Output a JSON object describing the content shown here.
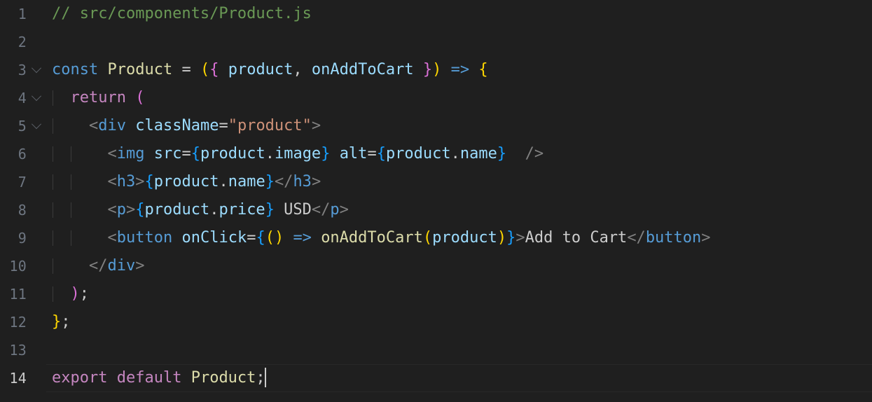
{
  "editor": {
    "file_name": "Product.js",
    "language": "javascript-react",
    "theme": "Dark Modern",
    "font_size_px": 22,
    "line_height_px": 40,
    "total_lines": 14,
    "active_line": 14,
    "cursor": {
      "line": 14,
      "column": 24
    },
    "colors": {
      "background": "#1f1f1f",
      "foreground": "#cccccc",
      "line_number": "#6e7681",
      "line_number_active": "#cccccc",
      "comment": "#6a9955",
      "keyword": "#569cd6",
      "control_keyword": "#c586c0",
      "identifier_type": "#dcdcaa",
      "variable": "#9cdcfe",
      "function": "#dcdcaa",
      "string": "#ce9178",
      "punctuation": "#808080",
      "bracket_level_1": "#ffd700",
      "bracket_level_2": "#da70d6",
      "bracket_level_3": "#179fff",
      "indent_guide": "#3b3b3b",
      "active_line_border": "#282828"
    }
  },
  "lines": [
    {
      "number": "1",
      "foldable": false,
      "indent_guides": 0,
      "plain_text": "// src/components/Product.js",
      "tokens": [
        {
          "text": "// src/components/Product.js",
          "cls": "t-comment"
        }
      ]
    },
    {
      "number": "2",
      "foldable": false,
      "indent_guides": 0,
      "plain_text": "",
      "tokens": []
    },
    {
      "number": "3",
      "foldable": true,
      "indent_guides": 0,
      "plain_text": "const Product = ({ product, onAddToCart }) => {",
      "tokens": [
        {
          "text": "const",
          "cls": "t-keyword"
        },
        {
          "text": " ",
          "cls": "t-plain"
        },
        {
          "text": "Product",
          "cls": "t-type"
        },
        {
          "text": " ",
          "cls": "t-plain"
        },
        {
          "text": "=",
          "cls": "t-plain"
        },
        {
          "text": " ",
          "cls": "t-plain"
        },
        {
          "text": "(",
          "cls": "b1"
        },
        {
          "text": "{",
          "cls": "b2"
        },
        {
          "text": " ",
          "cls": "t-plain"
        },
        {
          "text": "product",
          "cls": "t-var"
        },
        {
          "text": ",",
          "cls": "t-plain"
        },
        {
          "text": " ",
          "cls": "t-plain"
        },
        {
          "text": "onAddToCart",
          "cls": "t-var"
        },
        {
          "text": " ",
          "cls": "t-plain"
        },
        {
          "text": "}",
          "cls": "b2"
        },
        {
          "text": ")",
          "cls": "b1"
        },
        {
          "text": " ",
          "cls": "t-plain"
        },
        {
          "text": "=>",
          "cls": "t-arrow"
        },
        {
          "text": " ",
          "cls": "t-plain"
        },
        {
          "text": "{",
          "cls": "b1"
        }
      ]
    },
    {
      "number": "4",
      "foldable": true,
      "indent_guides": 1,
      "plain_text": "  return (",
      "tokens": [
        {
          "text": "  ",
          "cls": "t-plain"
        },
        {
          "text": "return",
          "cls": "t-control"
        },
        {
          "text": " ",
          "cls": "t-plain"
        },
        {
          "text": "(",
          "cls": "b2"
        }
      ]
    },
    {
      "number": "5",
      "foldable": true,
      "indent_guides": 1,
      "plain_text": "    <div className=\"product\">",
      "tokens": [
        {
          "text": "    ",
          "cls": "t-plain"
        },
        {
          "text": "<",
          "cls": "t-bracket-punct"
        },
        {
          "text": "div",
          "cls": "t-tag"
        },
        {
          "text": " ",
          "cls": "t-plain"
        },
        {
          "text": "className",
          "cls": "t-var"
        },
        {
          "text": "=",
          "cls": "t-plain"
        },
        {
          "text": "\"product\"",
          "cls": "t-string"
        },
        {
          "text": ">",
          "cls": "t-bracket-punct"
        }
      ]
    },
    {
      "number": "6",
      "foldable": false,
      "indent_guides": 2,
      "plain_text": "      <img src={product.image} alt={product.name}  />",
      "tokens": [
        {
          "text": "      ",
          "cls": "t-plain"
        },
        {
          "text": "<",
          "cls": "t-bracket-punct"
        },
        {
          "text": "img",
          "cls": "t-tag"
        },
        {
          "text": " ",
          "cls": "t-plain"
        },
        {
          "text": "src",
          "cls": "t-var"
        },
        {
          "text": "=",
          "cls": "t-plain"
        },
        {
          "text": "{",
          "cls": "b3"
        },
        {
          "text": "product",
          "cls": "t-var"
        },
        {
          "text": ".",
          "cls": "t-plain"
        },
        {
          "text": "image",
          "cls": "t-var"
        },
        {
          "text": "}",
          "cls": "b3"
        },
        {
          "text": " ",
          "cls": "t-plain"
        },
        {
          "text": "alt",
          "cls": "t-var"
        },
        {
          "text": "=",
          "cls": "t-plain"
        },
        {
          "text": "{",
          "cls": "b3"
        },
        {
          "text": "product",
          "cls": "t-var"
        },
        {
          "text": ".",
          "cls": "t-plain"
        },
        {
          "text": "name",
          "cls": "t-var"
        },
        {
          "text": "}",
          "cls": "b3"
        },
        {
          "text": "  ",
          "cls": "t-plain"
        },
        {
          "text": "/>",
          "cls": "t-bracket-punct"
        }
      ]
    },
    {
      "number": "7",
      "foldable": false,
      "indent_guides": 2,
      "plain_text": "      <h3>{product.name}</h3>",
      "tokens": [
        {
          "text": "      ",
          "cls": "t-plain"
        },
        {
          "text": "<",
          "cls": "t-bracket-punct"
        },
        {
          "text": "h3",
          "cls": "t-tag"
        },
        {
          "text": ">",
          "cls": "t-bracket-punct"
        },
        {
          "text": "{",
          "cls": "b3"
        },
        {
          "text": "product",
          "cls": "t-var"
        },
        {
          "text": ".",
          "cls": "t-plain"
        },
        {
          "text": "name",
          "cls": "t-var"
        },
        {
          "text": "}",
          "cls": "b3"
        },
        {
          "text": "</",
          "cls": "t-bracket-punct"
        },
        {
          "text": "h3",
          "cls": "t-tag"
        },
        {
          "text": ">",
          "cls": "t-bracket-punct"
        }
      ]
    },
    {
      "number": "8",
      "foldable": false,
      "indent_guides": 2,
      "plain_text": "      <p>{product.price} USD</p>",
      "tokens": [
        {
          "text": "      ",
          "cls": "t-plain"
        },
        {
          "text": "<",
          "cls": "t-bracket-punct"
        },
        {
          "text": "p",
          "cls": "t-tag"
        },
        {
          "text": ">",
          "cls": "t-bracket-punct"
        },
        {
          "text": "{",
          "cls": "b3"
        },
        {
          "text": "product",
          "cls": "t-var"
        },
        {
          "text": ".",
          "cls": "t-plain"
        },
        {
          "text": "price",
          "cls": "t-var"
        },
        {
          "text": "}",
          "cls": "b3"
        },
        {
          "text": " USD",
          "cls": "t-jsxtext"
        },
        {
          "text": "</",
          "cls": "t-bracket-punct"
        },
        {
          "text": "p",
          "cls": "t-tag"
        },
        {
          "text": ">",
          "cls": "t-bracket-punct"
        }
      ]
    },
    {
      "number": "9",
      "foldable": false,
      "indent_guides": 2,
      "plain_text": "      <button onClick={() => onAddToCart(product)}>Add to Cart</button>",
      "tokens": [
        {
          "text": "      ",
          "cls": "t-plain"
        },
        {
          "text": "<",
          "cls": "t-bracket-punct"
        },
        {
          "text": "button",
          "cls": "t-tag"
        },
        {
          "text": " ",
          "cls": "t-plain"
        },
        {
          "text": "onClick",
          "cls": "t-var"
        },
        {
          "text": "=",
          "cls": "t-plain"
        },
        {
          "text": "{",
          "cls": "b3"
        },
        {
          "text": "(",
          "cls": "b1"
        },
        {
          "text": ")",
          "cls": "b1"
        },
        {
          "text": " ",
          "cls": "t-plain"
        },
        {
          "text": "=>",
          "cls": "t-arrow"
        },
        {
          "text": " ",
          "cls": "t-plain"
        },
        {
          "text": "onAddToCart",
          "cls": "t-fn"
        },
        {
          "text": "(",
          "cls": "b1"
        },
        {
          "text": "product",
          "cls": "t-var"
        },
        {
          "text": ")",
          "cls": "b1"
        },
        {
          "text": "}",
          "cls": "b3"
        },
        {
          "text": ">",
          "cls": "t-bracket-punct"
        },
        {
          "text": "Add to Cart",
          "cls": "t-jsxtext"
        },
        {
          "text": "</",
          "cls": "t-bracket-punct"
        },
        {
          "text": "button",
          "cls": "t-tag"
        },
        {
          "text": ">",
          "cls": "t-bracket-punct"
        }
      ]
    },
    {
      "number": "10",
      "foldable": false,
      "indent_guides": 1,
      "plain_text": "    </div>",
      "tokens": [
        {
          "text": "    ",
          "cls": "t-plain"
        },
        {
          "text": "</",
          "cls": "t-bracket-punct"
        },
        {
          "text": "div",
          "cls": "t-tag"
        },
        {
          "text": ">",
          "cls": "t-bracket-punct"
        }
      ]
    },
    {
      "number": "11",
      "foldable": false,
      "indent_guides": 1,
      "plain_text": "  );",
      "tokens": [
        {
          "text": "  ",
          "cls": "t-plain"
        },
        {
          "text": ")",
          "cls": "b2"
        },
        {
          "text": ";",
          "cls": "t-plain"
        }
      ]
    },
    {
      "number": "12",
      "foldable": false,
      "indent_guides": 0,
      "plain_text": "};",
      "tokens": [
        {
          "text": "}",
          "cls": "b1"
        },
        {
          "text": ";",
          "cls": "t-plain"
        }
      ]
    },
    {
      "number": "13",
      "foldable": false,
      "indent_guides": 0,
      "plain_text": "",
      "tokens": []
    },
    {
      "number": "14",
      "foldable": false,
      "indent_guides": 0,
      "active": true,
      "has_caret": true,
      "plain_text": "export default Product;",
      "tokens": [
        {
          "text": "export",
          "cls": "t-control"
        },
        {
          "text": " ",
          "cls": "t-plain"
        },
        {
          "text": "default",
          "cls": "t-control"
        },
        {
          "text": " ",
          "cls": "t-plain"
        },
        {
          "text": "Product",
          "cls": "t-type"
        },
        {
          "text": ";",
          "cls": "t-plain"
        }
      ]
    }
  ],
  "clipped_top_line": {
    "plain_text": "// src/components/Product.js",
    "tokens": [
      {
        "text": "// src/components/Product.js",
        "cls": "t-comment"
      }
    ]
  }
}
